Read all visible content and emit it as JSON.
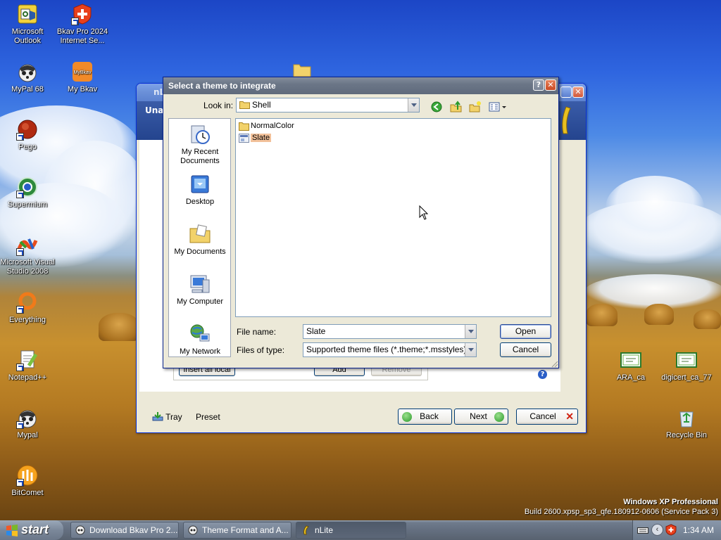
{
  "desktop": {
    "icons_left": [
      {
        "label": "Microsoft Outlook",
        "icon": "outlook-icon"
      },
      {
        "label": "MyPal 68",
        "icon": "mypal-icon"
      },
      {
        "label": "Pego",
        "icon": "pego-icon"
      },
      {
        "label": "Supermium",
        "icon": "supermium-icon"
      },
      {
        "label": "Microsoft Visual Studio 2008",
        "icon": "visual-studio-icon"
      },
      {
        "label": "Everything",
        "icon": "everything-icon"
      },
      {
        "label": "Notepad++",
        "icon": "notepadpp-icon"
      },
      {
        "label": "Mypal",
        "icon": "mypal-icon"
      },
      {
        "label": "BitComet",
        "icon": "bitcomet-icon"
      }
    ],
    "icons_col2": [
      {
        "label": "Bkav Pro 2024 Internet Se...",
        "icon": "bkav-icon"
      },
      {
        "label": "My Bkav",
        "icon": "mybkav-icon",
        "badge": "MyBkav"
      }
    ],
    "icons_right": [
      {
        "label": "ARA_ca",
        "icon": "certificate-icon"
      },
      {
        "label": "digicert_ca_77",
        "icon": "certificate-icon"
      },
      {
        "label": "Recycle Bin",
        "icon": "recycle-bin-icon"
      }
    ],
    "watermark_line1": "Windows XP Professional",
    "watermark_line2": "Build 2600.xpsp_sp3_qfe.180912-0606 (Service Pack 3)"
  },
  "nlite": {
    "title": "nLite",
    "banner_title": "Unattended",
    "buttons": {
      "insert_all_local": "Insert all local",
      "add": "Add",
      "remove": "Remove",
      "tray": "Tray",
      "preset": "Preset",
      "back": "Back",
      "next": "Next",
      "cancel": "Cancel"
    }
  },
  "dialog": {
    "title": "Select a theme to integrate",
    "look_in_label": "Look in:",
    "look_in_value": "Shell",
    "places": [
      "My Recent Documents",
      "Desktop",
      "My Documents",
      "My Computer",
      "My Network"
    ],
    "files": [
      {
        "name": "NormalColor",
        "type": "folder",
        "selected": false
      },
      {
        "name": "Slate",
        "type": "theme",
        "selected": true
      }
    ],
    "file_name_label": "File name:",
    "file_name_value": "Slate",
    "files_of_type_label": "Files of type:",
    "files_of_type_value": "Supported theme files (*.theme;*.msstyles)",
    "open_button": "Open",
    "cancel_button": "Cancel"
  },
  "taskbar": {
    "start_label": "start",
    "tasks": [
      {
        "label": "Download Bkav Pro 2...",
        "active": false
      },
      {
        "label": "Theme Format and A...",
        "active": false
      },
      {
        "label": "nLite",
        "active": true
      }
    ],
    "clock": "1:34 AM"
  }
}
